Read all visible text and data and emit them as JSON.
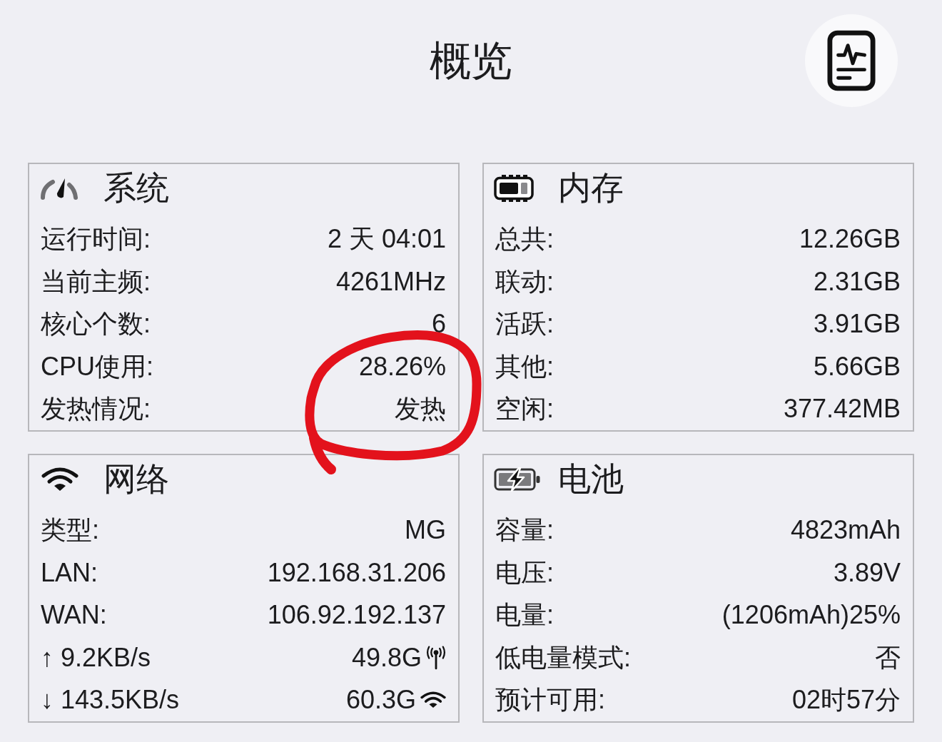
{
  "title": "概览",
  "panels": [
    {
      "kind": "system",
      "title": "系统",
      "rows": [
        {
          "kind": "plain",
          "label": "运行时间:",
          "value": "2 天 04:01"
        },
        {
          "kind": "plain",
          "label": "当前主频:",
          "value": "4261MHz"
        },
        {
          "kind": "plain",
          "label": "核心个数:",
          "value": "6"
        },
        {
          "kind": "plain",
          "label": "CPU使用:",
          "value": "28.26%"
        },
        {
          "kind": "plain",
          "label": "发热情况:",
          "value": "发热"
        }
      ]
    },
    {
      "kind": "memory",
      "title": "内存",
      "rows": [
        {
          "kind": "plain",
          "label": "总共:",
          "value": "12.26GB"
        },
        {
          "kind": "plain",
          "label": "联动:",
          "value": "2.31GB"
        },
        {
          "kind": "plain",
          "label": "活跃:",
          "value": "3.91GB"
        },
        {
          "kind": "plain",
          "label": "其他:",
          "value": "5.66GB"
        },
        {
          "kind": "plain",
          "label": "空闲:",
          "value": "377.42MB"
        }
      ]
    },
    {
      "kind": "network",
      "title": "网络",
      "rows": [
        {
          "kind": "plain",
          "label": "类型:",
          "value": "MG"
        },
        {
          "kind": "plain",
          "label": "LAN:",
          "value": "192.168.31.206"
        },
        {
          "kind": "plain",
          "label": "WAN:",
          "value": "106.92.192.137"
        },
        {
          "kind": "cellular",
          "label": "↑ 9.2KB/s",
          "value": "49.8G"
        },
        {
          "kind": "wifi",
          "label": "↓ 143.5KB/s",
          "value": "60.3G"
        }
      ]
    },
    {
      "kind": "battery",
      "title": "电池",
      "rows": [
        {
          "kind": "plain",
          "label": "容量:",
          "value": "4823mAh"
        },
        {
          "kind": "plain",
          "label": "电压:",
          "value": "3.89V"
        },
        {
          "kind": "plain",
          "label": "电量:",
          "value": "(1206mAh)25%"
        },
        {
          "kind": "plain",
          "label": "低电量模式:",
          "value": "否"
        },
        {
          "kind": "plain",
          "label": "预计可用:",
          "value": "02时57分"
        }
      ]
    }
  ]
}
